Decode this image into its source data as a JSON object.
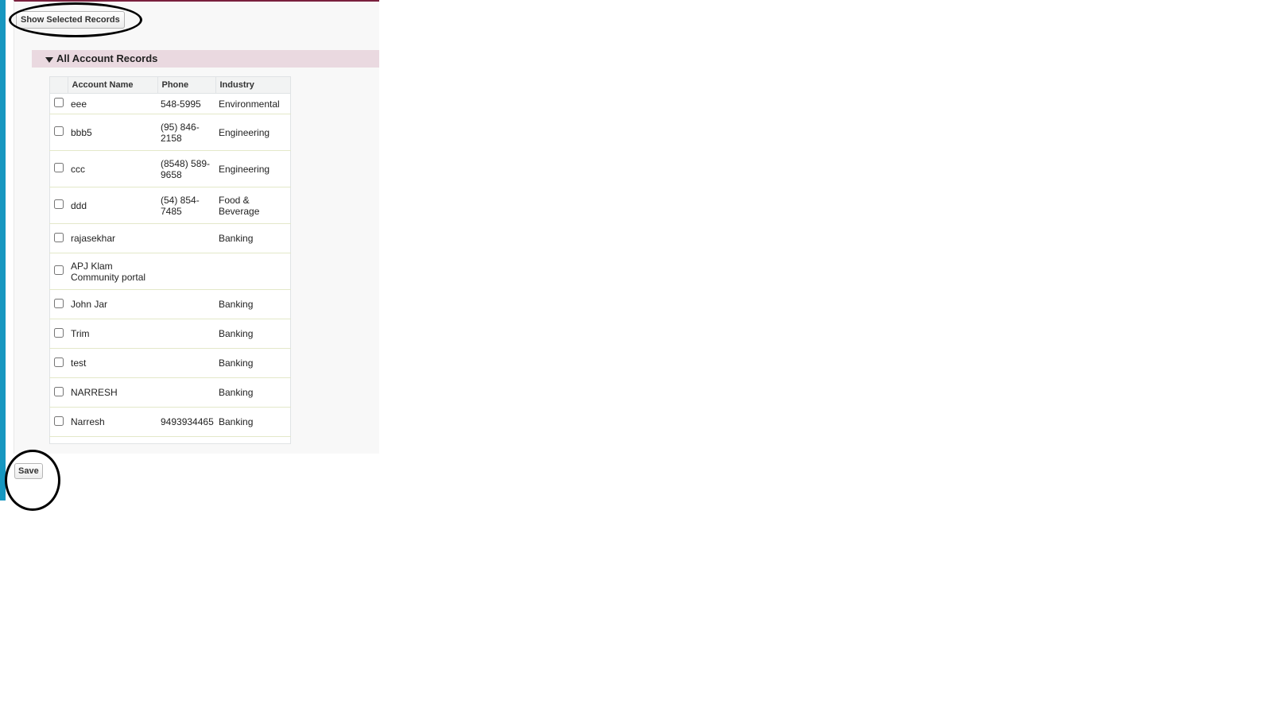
{
  "buttons": {
    "show_selected": "Show Selected Records",
    "save": "Save"
  },
  "section": {
    "title": "All Account Records"
  },
  "table": {
    "columns": [
      "Account Name",
      "Phone",
      "Industry"
    ],
    "rows": [
      {
        "name": "eee",
        "phone": "548-5995",
        "industry": "Environmental",
        "checked": false
      },
      {
        "name": "bbb5",
        "phone": "(95) 846-2158",
        "industry": "Engineering",
        "checked": false
      },
      {
        "name": "ccc",
        "phone": "(8548) 589-9658",
        "industry": "Engineering",
        "checked": false
      },
      {
        "name": "ddd",
        "phone": "(54) 854-7485",
        "industry": "Food & Beverage",
        "checked": false
      },
      {
        "name": "rajasekhar",
        "phone": "",
        "industry": "Banking",
        "checked": false
      },
      {
        "name": "APJ Klam Community portal",
        "phone": "",
        "industry": "",
        "checked": false
      },
      {
        "name": "John Jar",
        "phone": "",
        "industry": "Banking",
        "checked": false
      },
      {
        "name": "Trim",
        "phone": "",
        "industry": "Banking",
        "checked": false
      },
      {
        "name": "test",
        "phone": "",
        "industry": "Banking",
        "checked": false
      },
      {
        "name": "NARRESH",
        "phone": "",
        "industry": "Banking",
        "checked": false
      },
      {
        "name": "Narresh",
        "phone": "9493934465",
        "industry": "Banking",
        "checked": false
      }
    ]
  },
  "colors": {
    "accent_bar": "#1797c0",
    "section_header_bg": "#ead9e0",
    "panel_top_border": "#7a1f3d",
    "annotation": "#000000"
  }
}
